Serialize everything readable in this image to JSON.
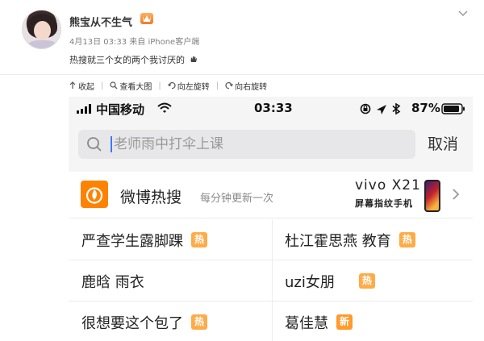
{
  "post": {
    "user_name": "熊宝从不生气",
    "vip_badge": "",
    "date": "4月13日 03:33",
    "source": "来自 iPhone客户端",
    "text": "热搜就三个女的两个我讨厌的"
  },
  "actions": [
    {
      "label": "收起",
      "icon": "collapse-icon"
    },
    {
      "label": "查看大图",
      "icon": "zoom-icon"
    },
    {
      "label": "向左旋转",
      "icon": "rotate-left-icon"
    },
    {
      "label": "向右旋转",
      "icon": "rotate-right-icon"
    }
  ],
  "screenshot": {
    "status_bar": {
      "carrier": "中国移动",
      "time": "03:33",
      "battery_pct": "87%"
    },
    "search": {
      "placeholder": "老师雨中打伞上课",
      "cancel_label": "取消"
    },
    "hot_header": {
      "title": "微博热搜",
      "subtitle": "每分钟更新一次",
      "ad_brand": "vivo X21",
      "ad_slogan": "屏幕指纹手机"
    },
    "hot_items": [
      {
        "left": "严查学生露脚踝",
        "left_tag": "热",
        "right": "杜江霍思燕 教育",
        "right_tag": "热"
      },
      {
        "left": "鹿晗 雨衣",
        "left_tag": "",
        "right": "uzi女朋",
        "right_tag": "热"
      },
      {
        "left": "很想要这个包了",
        "left_tag": "热",
        "right": "葛佳慧",
        "right_tag": "新"
      }
    ]
  },
  "colors": {
    "weibo_orange": "#ff8200",
    "hot_tag": "#ffab47",
    "search_cursor": "#3d7af0"
  }
}
